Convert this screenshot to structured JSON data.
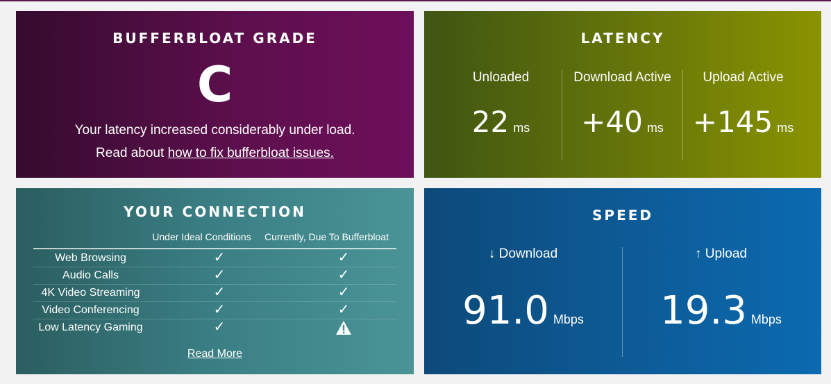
{
  "grade": {
    "title": "BUFFERBLOAT GRADE",
    "letter": "C",
    "message": "Your latency increased considerably under load.",
    "read_prefix": "Read about ",
    "link_text": "how to fix bufferbloat issues."
  },
  "latency": {
    "title": "LATENCY",
    "unit": "ms",
    "columns": [
      {
        "label": "Unloaded",
        "value": "22"
      },
      {
        "label": "Download Active",
        "value": "+40"
      },
      {
        "label": "Upload Active",
        "value": "+145"
      }
    ]
  },
  "connection": {
    "title": "YOUR CONNECTION",
    "col_ideal": "Under Ideal Conditions",
    "col_current": "Currently, Due To Bufferbloat",
    "rows": [
      {
        "label": "Web Browsing",
        "ideal": "check",
        "current": "check"
      },
      {
        "label": "Audio Calls",
        "ideal": "check",
        "current": "check"
      },
      {
        "label": "4K Video Streaming",
        "ideal": "check",
        "current": "check"
      },
      {
        "label": "Video Conferencing",
        "ideal": "check",
        "current": "check"
      },
      {
        "label": "Low Latency Gaming",
        "ideal": "check",
        "current": "warning"
      }
    ],
    "read_more": "Read More"
  },
  "speed": {
    "title": "SPEED",
    "unit": "Mbps",
    "download_label": "↓ Download",
    "download_value": "91.0",
    "upload_label": "↑ Upload",
    "upload_value": "19.3"
  }
}
